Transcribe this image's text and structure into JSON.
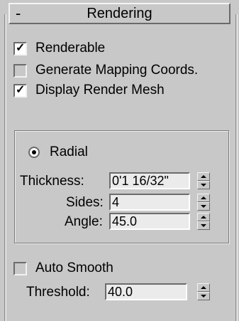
{
  "rollout": {
    "collapse_symbol": "-",
    "title": "Rendering"
  },
  "options": {
    "renderable": {
      "label": "Renderable",
      "checked": true
    },
    "generate_mapping": {
      "label": "Generate Mapping Coords.",
      "checked": false
    },
    "display_render_mesh": {
      "label": "Display Render Mesh",
      "checked": true
    }
  },
  "profile": {
    "radial": {
      "label": "Radial",
      "selected": true
    },
    "thickness": {
      "label": "Thickness:",
      "value": "0'1 16/32\""
    },
    "sides": {
      "label": "Sides:",
      "value": "4"
    },
    "angle": {
      "label": "Angle:",
      "value": "45.0"
    }
  },
  "smoothing": {
    "auto_smooth": {
      "label": "Auto Smooth",
      "checked": false
    },
    "threshold": {
      "label": "Threshold:",
      "value": "40.0"
    }
  },
  "glyphs": {
    "checkmark": "✓"
  }
}
